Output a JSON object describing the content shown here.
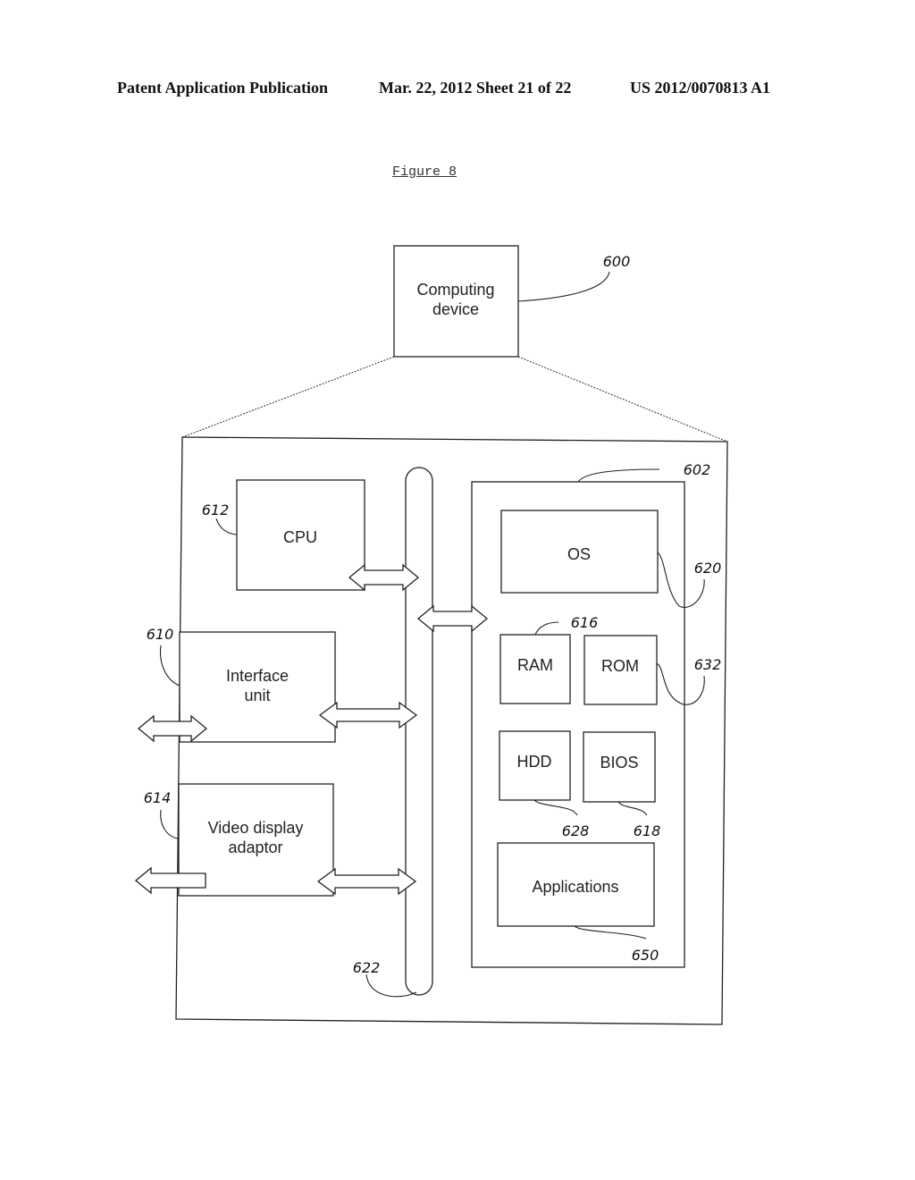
{
  "header": {
    "publication": "Patent Application Publication",
    "date_sheet": "Mar. 22, 2012  Sheet 21 of 22",
    "number": "US 2012/0070813 A1"
  },
  "figure": {
    "title": "Figure 8",
    "computing_device": {
      "label_line1": "Computing",
      "label_line2": "device",
      "ref": "600"
    },
    "enclosure": {
      "ref": "602"
    },
    "cpu": {
      "label": "CPU",
      "ref": "612"
    },
    "interface_unit": {
      "label_line1": "Interface",
      "label_line2": "unit",
      "ref": "610"
    },
    "video_display_adaptor": {
      "label_line1": "Video display",
      "label_line2": "adaptor",
      "ref": "614"
    },
    "bus": {
      "ref": "622"
    },
    "os": {
      "label": "OS",
      "ref": "620"
    },
    "ram": {
      "label": "RAM",
      "ref": "616"
    },
    "rom": {
      "label": "ROM",
      "ref": "632"
    },
    "hdd": {
      "label": "HDD",
      "ref": "628"
    },
    "bios": {
      "label": "BIOS",
      "ref": "618"
    },
    "applications": {
      "label": "Applications",
      "ref": "650"
    }
  }
}
